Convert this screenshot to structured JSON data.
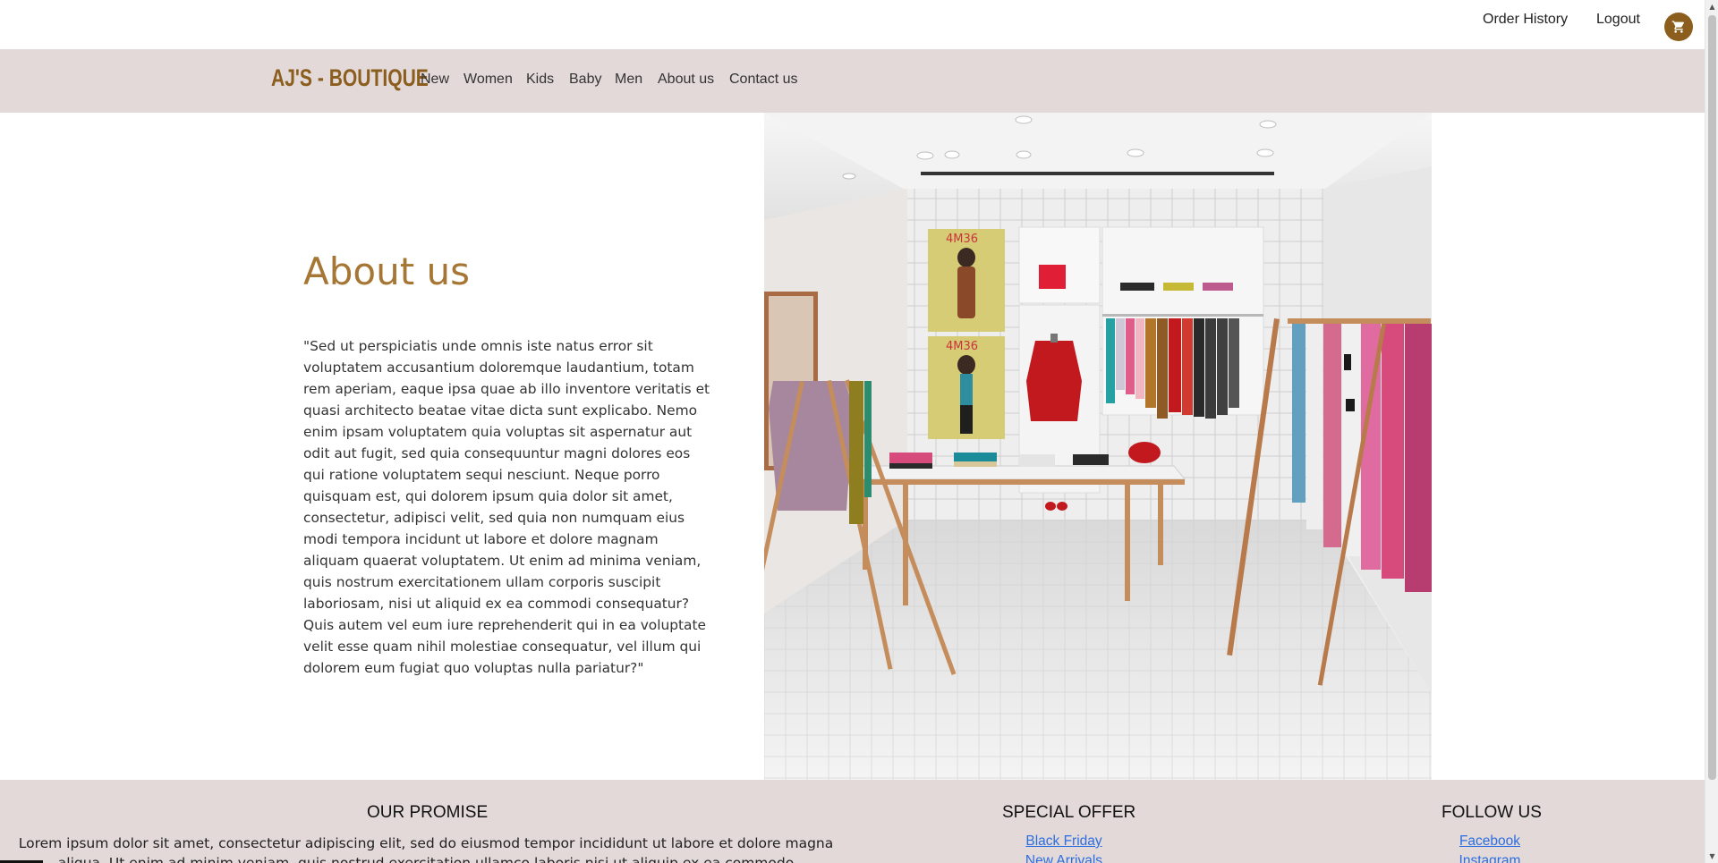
{
  "header": {
    "links": [
      "Order History",
      "Logout"
    ],
    "cart_icon": "shopping-cart-icon",
    "accent_color": "#8b5e1e"
  },
  "navbar": {
    "brand": "AJ'S - BOUTIQUE",
    "items": [
      "New",
      "Women",
      "Kids",
      "Baby",
      "Men",
      "About us",
      "Contact us"
    ],
    "background": "#e3d9d8"
  },
  "main": {
    "title": "About us",
    "body": "\"Sed ut perspiciatis unde omnis iste natus error sit voluptatem accusantium doloremque laudantium, totam rem aperiam, eaque ipsa quae ab illo inventore veritatis et quasi architecto beatae vitae dicta sunt explicabo. Nemo enim ipsam voluptatem quia voluptas sit aspernatur aut odit aut fugit, sed quia consequuntur magni dolores eos qui ratione voluptatem sequi nesciunt. Neque porro quisquam est, qui dolorem ipsum quia dolor sit amet, consectetur, adipisci velit, sed quia non numquam eius modi tempora incidunt ut labore et dolore magnam aliquam quaerat voluptatem. Ut enim ad minima veniam, quis nostrum exercitationem ullam corporis suscipit laboriosam, nisi ut aliquid ex ea commodi consequatur? Quis autem vel eum iure reprehenderit qui in ea voluptate velit esse quam nihil molestiae consequatur, vel illum qui dolorem eum fugiat quo voluptas nulla pariatur?\"",
    "title_color": "#a57634",
    "poster_text": [
      "4M36",
      "4M36"
    ]
  },
  "footer": {
    "promise": {
      "heading": "OUR PROMISE",
      "text": "Lorem ipsum dolor sit amet, consectetur adipiscing elit, sed do eiusmod tempor incididunt ut labore et dolore magna aliqua. Ut enim ad minim veniam, quis nostrud exercitation ullamco laboris nisi ut aliquip ex ea commodo consequat."
    },
    "offer": {
      "heading": "SPECIAL OFFER",
      "links": [
        "Black Friday",
        "New Arrivals"
      ]
    },
    "follow": {
      "heading": "FOLLOW US",
      "links": [
        "Facebook",
        "Instagram"
      ]
    }
  }
}
